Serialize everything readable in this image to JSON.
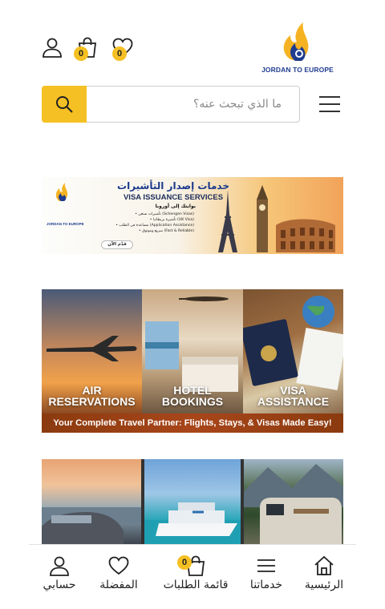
{
  "header": {
    "logo_text": "JORDAN TO EUROPE",
    "wishlist_count": "0",
    "cart_count": "0",
    "icons": [
      "user-icon",
      "shopping-bag-icon",
      "heart-icon"
    ]
  },
  "search": {
    "placeholder": "ما الذي تبحث عنه؟",
    "icons": [
      "search-icon",
      "menu-icon"
    ]
  },
  "banner_visa": {
    "logo_text": "JORDAN TO EUROPE",
    "title_ar": "خدمات إصدار التأشيرات",
    "title_en": "VISA ISSUANCE SERVICES",
    "subtitle_ar": "بوابتك إلى أوروبا",
    "bullets": [
      "• تأشيرات شنغن (Schengen Visas)",
      "• تأشيرة بريطانيا (UK Visa)",
      "• مساعدة في الطلب (Application Assistance)",
      "• سريع وموثوق (Fast & Reliable)"
    ],
    "cta": "قدّم الآن"
  },
  "banner_services": {
    "panels": [
      {
        "line1": "AIR",
        "line2": "RESERVATIONS"
      },
      {
        "line1": "HOTEL",
        "line2": "BOOKINGS"
      },
      {
        "line1": "VISA",
        "line2": "ASSISTANCE"
      }
    ],
    "tagline": "Your Complete Travel Partner: Flights, Stays, & Visas Made Easy!"
  },
  "bottom_nav": {
    "items": [
      {
        "label": "الرئيسية",
        "icon": "home-icon"
      },
      {
        "label": "خدماتنا",
        "icon": "menu-icon"
      },
      {
        "label": "قائمة الطلبات",
        "icon": "shopping-bag-icon",
        "badge": "0"
      },
      {
        "label": "المفضلة",
        "icon": "heart-icon"
      },
      {
        "label": "حسابي",
        "icon": "user-icon"
      }
    ]
  },
  "colors": {
    "accent": "#f5c023",
    "brand_blue": "#1f3c8f",
    "strip": "#a8461a"
  }
}
